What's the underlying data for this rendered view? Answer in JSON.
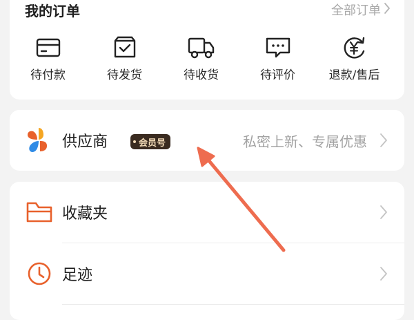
{
  "orders": {
    "title": "我的订单",
    "all_link": "全部订单",
    "items": [
      {
        "label": "待付款",
        "icon": "card-icon"
      },
      {
        "label": "待发货",
        "icon": "box-check-icon"
      },
      {
        "label": "待收货",
        "icon": "truck-icon"
      },
      {
        "label": "待评价",
        "icon": "comment-icon"
      },
      {
        "label": "退款/售后",
        "icon": "refund-yen-icon"
      }
    ]
  },
  "supplier": {
    "label": "供应商",
    "badge": "会员号",
    "description": "私密上新、专属优惠",
    "icon": "supplier-logo-icon"
  },
  "menu": {
    "items": [
      {
        "label": "收藏夹",
        "icon": "folder-icon"
      },
      {
        "label": "足迹",
        "icon": "clock-icon"
      }
    ]
  },
  "colors": {
    "accent": "#e8612c",
    "annotation_arrow": "#ee6c4f",
    "text_primary": "#1f1f1f",
    "text_secondary": "#a3a3a3",
    "badge_bg": "#3a2b20",
    "badge_text": "#f4dcb8"
  }
}
